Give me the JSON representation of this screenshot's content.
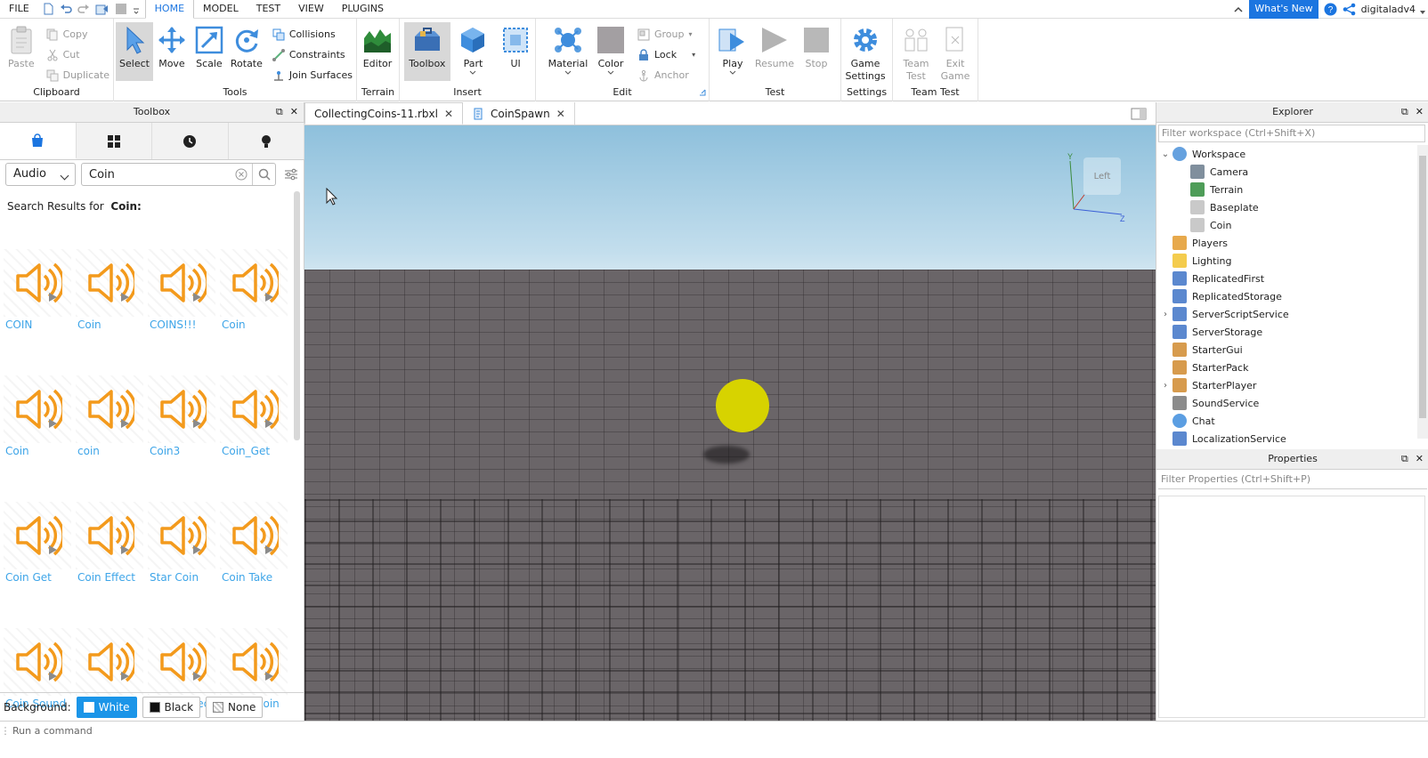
{
  "menubar": {
    "items": [
      "FILE",
      "HOME",
      "MODEL",
      "TEST",
      "VIEW",
      "PLUGINS"
    ],
    "active": "HOME",
    "whats_new": "What's New",
    "user": "digitaladv4"
  },
  "ribbon": {
    "clipboard": {
      "label": "Clipboard",
      "paste": "Paste",
      "copy": "Copy",
      "cut": "Cut",
      "duplicate": "Duplicate"
    },
    "tools": {
      "label": "Tools",
      "select": "Select",
      "move": "Move",
      "scale": "Scale",
      "rotate": "Rotate",
      "collisions": "Collisions",
      "constraints": "Constraints",
      "join": "Join Surfaces"
    },
    "terrain": {
      "label": "Terrain",
      "editor": "Editor"
    },
    "insert": {
      "label": "Insert",
      "toolbox": "Toolbox",
      "part": "Part",
      "ui": "UI"
    },
    "edit": {
      "label": "Edit",
      "material": "Material",
      "color": "Color",
      "group": "Group",
      "lock": "Lock",
      "anchor": "Anchor"
    },
    "test": {
      "label": "Test",
      "play": "Play",
      "resume": "Resume",
      "stop": "Stop"
    },
    "settings": {
      "label": "Settings",
      "game_settings_1": "Game",
      "game_settings_2": "Settings"
    },
    "team_test": {
      "label": "Team Test",
      "team_1": "Team",
      "team_2": "Test",
      "exit_1": "Exit",
      "exit_2": "Game"
    }
  },
  "toolbox": {
    "title": "Toolbox",
    "category": "Audio",
    "query": "Coin",
    "results_prefix": "Search Results for",
    "results_query": "Coin:",
    "assets": [
      "COIN",
      "Coin",
      "COINS!!!",
      "Coin",
      "Coin",
      "coin",
      "Coin3",
      "Coin_Get",
      "Coin Get",
      "Coin Effect",
      "Star Coin",
      "Coin Take",
      "Coin Sound",
      "Pickup coin",
      "Coin_collect",
      "Lucky Coin"
    ],
    "background_label": "Background:",
    "bg_white": "White",
    "bg_black": "Black",
    "bg_none": "None"
  },
  "doc_tabs": {
    "tab1": "CollectingCoins-11.rbxl",
    "tab2": "CoinSpawn"
  },
  "viewport": {
    "cube_label": "Left",
    "axis_y": "Y",
    "axis_z": "Z"
  },
  "explorer": {
    "title": "Explorer",
    "filter_placeholder": "Filter workspace (Ctrl+Shift+X)",
    "items": [
      "Workspace",
      "Camera",
      "Terrain",
      "Baseplate",
      "Coin",
      "Players",
      "Lighting",
      "ReplicatedFirst",
      "ReplicatedStorage",
      "ServerScriptService",
      "ServerStorage",
      "StarterGui",
      "StarterPack",
      "StarterPlayer",
      "SoundService",
      "Chat",
      "LocalizationService"
    ]
  },
  "properties": {
    "title": "Properties",
    "filter_placeholder": "Filter Properties (Ctrl+Shift+P)"
  },
  "command_bar": {
    "placeholder": "Run a command"
  },
  "colors": {
    "accent": "#1b75e0",
    "coin": "#d7d300",
    "asset_link": "#3ea5e8",
    "speaker": "#f39a1c"
  }
}
